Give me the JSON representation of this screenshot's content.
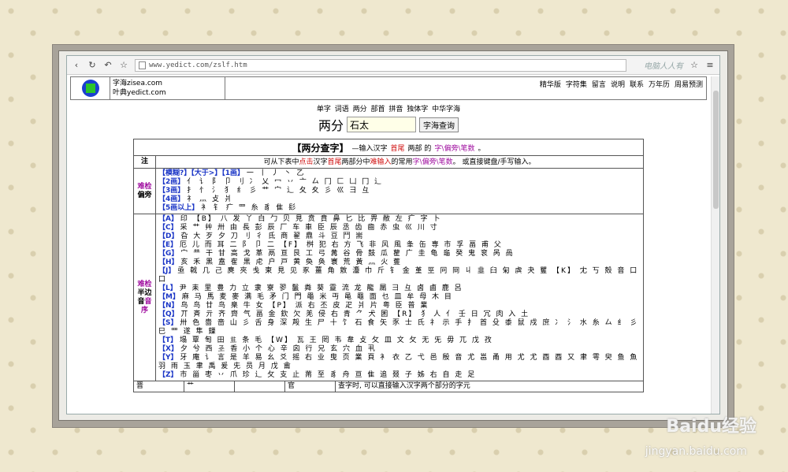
{
  "browser": {
    "url": "www.yedict.com/zslf.htm",
    "logo_text": "电脑人人有"
  },
  "header": {
    "sites": [
      "字海zisea.com",
      "叶典yedict.com"
    ],
    "nav": [
      "精华版",
      "字符集",
      "留言",
      "说明",
      "联系",
      "万年历",
      "周易预测"
    ]
  },
  "main_nav": "单字 词语 两分 部首 拼音 独体字 中华字海",
  "search": {
    "label": "两分",
    "value": "石太",
    "button": "字海查询"
  },
  "panel": {
    "title": "【两分查字】",
    "subtitle_prefix": "—输入汉字",
    "subtitle_red": "首尾",
    "subtitle_mid": "两部 的",
    "subtitle_purple": "字\\偏旁\\笔数",
    "subtitle_end": "。",
    "note_label": "注",
    "note_a": "可从下表中",
    "note_red1": "点击",
    "note_b": "汉字",
    "note_red2": "首尾",
    "note_c": "两部分中",
    "note_red3": "难输入",
    "note_d": "的常用",
    "note_purple": "字\\偏旁\\笔数",
    "note_e": "。 或直接键盘/手写输入。",
    "radicals_label_1": "难检",
    "radicals_label_2": "偏旁",
    "radicals": [
      {
        "tag": "【模糊?】【大于>】【1画】",
        "chars": "一 丨 丿 丶 乙"
      },
      {
        "tag": "【2画】",
        "chars": "亻 讠 阝 卩 刂 冫 乂 冖 丷 亠 厶 冂 匚 凵 冂 辶"
      },
      {
        "tag": "【3画】",
        "chars": "扌 忄 氵 犭 纟 彡 艹 宀 辶 夂 夊 彡 巛 彐 彑"
      },
      {
        "tag": "【4画】",
        "chars": "礻 灬 攴 爿"
      },
      {
        "tag": "【5画以上】",
        "chars": "衤 钅 疒 罒 糸 豸 隹 髟"
      }
    ],
    "halves_label_1": "难检",
    "halves_label_2": "半边",
    "halves_label_3a": "音",
    "halves_label_3b": "音",
    "halves_label_4": "序",
    "halves": [
      {
        "tag": "【A】",
        "chars": "印 【B】 八 发 丫 白 勹 贝 見 贲 賁 鼻 匕 比 畀 敝 左 疒 字 卜"
      },
      {
        "tag": "【C】",
        "chars": "采 艹 艸 卅 由 長 彭 辰 厂 车 車 臣 辰 丞 齿 齒 赤 虫 巛 川 寸"
      },
      {
        "tag": "【D】",
        "chars": "旮 大 歹 夕 刀 刂 彳 氐 商 翟 鼎 斗 豆 鬥 耑"
      },
      {
        "tag": "【E】",
        "chars": "厄 儿 而 耳 二 阝 卩 二 【F】 桝 犯 右 方 飞 非 风 風 夆 缶 専 市 孚 畐 甫 父"
      },
      {
        "tag": "【G】",
        "chars": "宀 龷 干 甘 高 戈 革 鬲 亘 艮 工 弓 冓 谷 骨 鼓 瓜 雚 广 圭 龟 龜 癸 鬼 衮 呙 咼"
      },
      {
        "tag": "【H】",
        "chars": "亥 禾 黑 盍 隺 黒 虍 户 戸 黄 奐 奂 寰 荒 黃 灬 火 蒦"
      },
      {
        "tag": "【J】",
        "chars": "亟 戟 几 己 麂 夾 戋 柬 見 见 豖 薑 角 敫 灋 巾 斤 钅 金 堇 巠 冋 冏 丩 韭 臼 匊 虡 夬 矍 【K】 冘 丂 殻 音 口 口"
      },
      {
        "tag": "【L】",
        "chars": "尹 耒 里 豊 力 立 隶 寮 翏 鬣 粦 葵 靈 流 龙 龍 屚 彐 彑 卤 鹵 鹿 呂"
      },
      {
        "tag": "【M】",
        "chars": "麻 马 馬 麦 麥 满 毛 矛 门 門 黽 米 丏 黾 黽 面 乜 皿 牟 母 木 目"
      },
      {
        "tag": "【N】",
        "chars": "鸟 鸟 廿 鸟 臬 牛 女 【P】 派 右 丕 皮 疋 爿 片 粤 臣 普 業"
      },
      {
        "tag": "【Q】",
        "chars": "丌 斉 亓 齐 齊 气 畐 金 欽 欠 羌 侵 右 青 ⺈ 犬 囷 【R】 犭 人 亻 壬 日 冗 肉 入 土"
      },
      {
        "tag": "【S】",
        "chars": "卅 色 嗇 啬 山 彡 舌 身 深 殸 生 尸 十 饣 石 食 矢 豕 士 氏 礻 示 手 扌 首 殳 黍 鼠 戍 庶 冫 氵 水 糸 厶 纟 彡 巳 罒 遂 隼 鏁"
      },
      {
        "tag": "【T】",
        "chars": "塌 覃 匋 田 𠀎 条 毛 【W】 瓦 王 罔 韦 韋 攴 攵 皿 文 攵 无 旡 毋 兀 戊 孜"
      },
      {
        "tag": "【X】",
        "chars": "夕 兮 西 𢀖 香 小 个 心 辛 囟 行 兄 玄 穴 血 丮"
      },
      {
        "tag": "【Y】",
        "chars": "牙 庵 讠 言 是 羊 易 幺 爻 摇 右 业 曳 页 業 頁 衤 衣 乙 弋 邑 殷 音 尤 邕 甬 用 尤 尤 酉 酉 又 聿 雩 臾 鱼 魚 羽 雨 玉 聿 禹 爰 兂 员 月 戊 龠"
      },
      {
        "tag": "【Z】",
        "chars": "市 甾 枣 丷 爪 珍 辶 攵 支 止 黹 至 豸 舟 亘 隹 追 叕 子 姊 右 自 走 足"
      }
    ],
    "bottom_cells": [
      "晋",
      "艹",
      "",
      "官",
      "查字时, 可以直接输入汉字两个部分的字元"
    ]
  },
  "watermark": {
    "main": "Baidu经验",
    "sub": "jingyan.baidu.com"
  }
}
